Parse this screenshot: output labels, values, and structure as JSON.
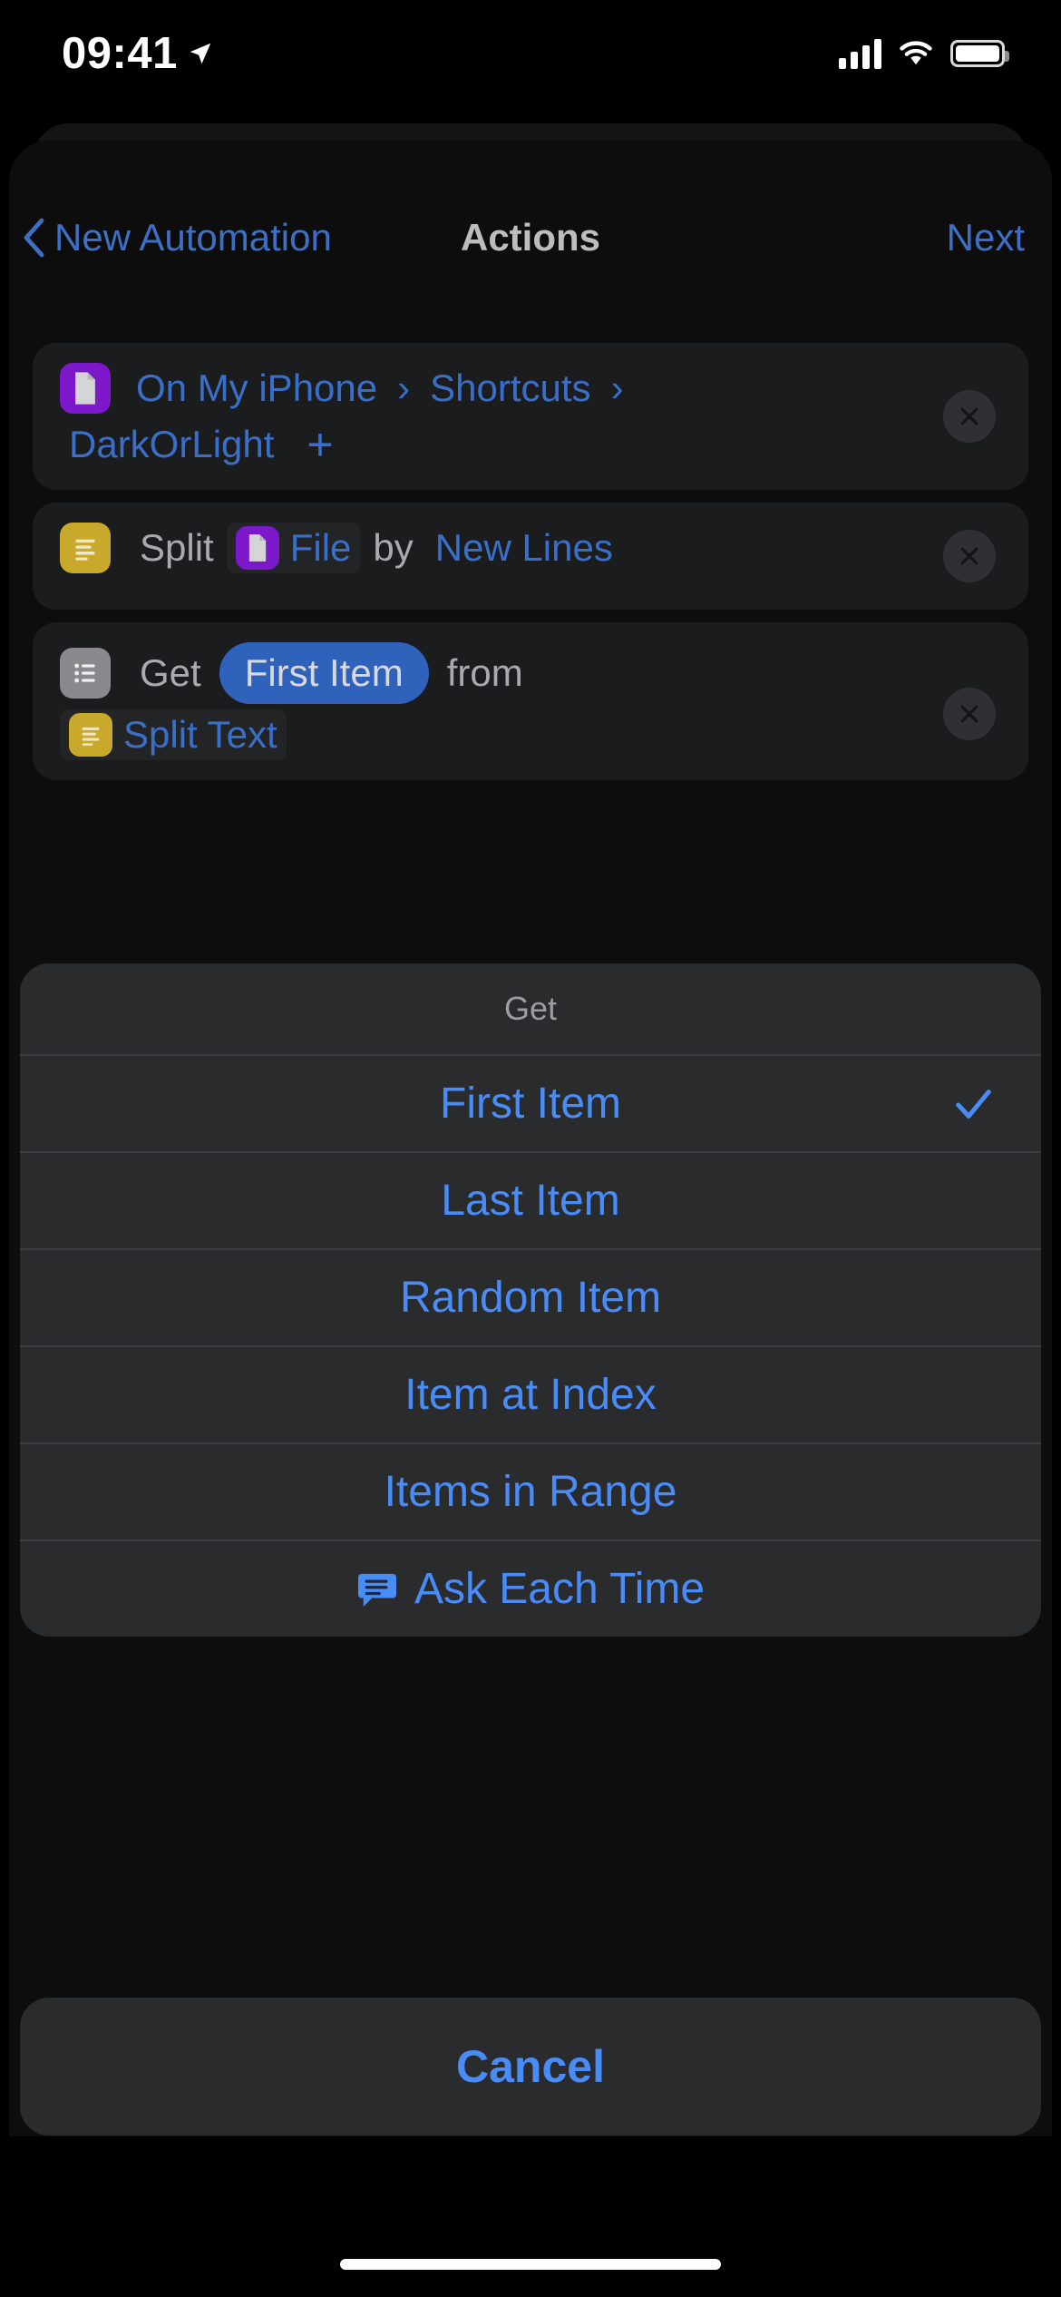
{
  "status_bar": {
    "time": "09:41",
    "location_icon": "location-arrow-icon",
    "cellular_icon": "cellular-bars-icon",
    "wifi_icon": "wifi-icon",
    "battery_icon": "battery-icon"
  },
  "nav": {
    "back_label": "New Automation",
    "title": "Actions",
    "next_label": "Next"
  },
  "actions": {
    "file_action": {
      "icon": "file-icon",
      "path_part_1": "On My iPhone",
      "separator_1": "›",
      "path_part_2": "Shortcuts",
      "separator_2": "›",
      "path_part_3": "DarkOrLight",
      "add_label": "+",
      "remove_label": "×"
    },
    "split_action": {
      "icon": "text-lines-icon",
      "verb": "Split",
      "input_icon": "file-icon",
      "input_token": "File",
      "connector_word": "by",
      "separator_token": "New Lines",
      "remove_label": "×"
    },
    "get_action": {
      "icon": "list-icon",
      "verb": "Get",
      "selected_item": "First Item",
      "connector_word": "from",
      "source_icon": "text-lines-icon",
      "source_token": "Split Text",
      "remove_label": "×"
    }
  },
  "action_sheet": {
    "header": "Get",
    "options": [
      {
        "label": "First Item",
        "selected": true,
        "check_icon": "checkmark-icon"
      },
      {
        "label": "Last Item",
        "selected": false
      },
      {
        "label": "Random Item",
        "selected": false
      },
      {
        "label": "Item at Index",
        "selected": false
      },
      {
        "label": "Items in Range",
        "selected": false
      },
      {
        "label": "Ask Each Time",
        "selected": false,
        "icon": "ask-bubble-icon"
      }
    ],
    "cancel_label": "Cancel"
  },
  "colors": {
    "accent_blue": "#4a8cf7",
    "link_blue": "#3a6fc9",
    "selected_pill": "#2f62bb",
    "file_purple": "#7b18c9",
    "text_yellow": "#c9a92c",
    "list_grey": "#8a8a8e",
    "sheet_bg": "#2a2b2d",
    "card_bg": "#1b1c1e"
  }
}
